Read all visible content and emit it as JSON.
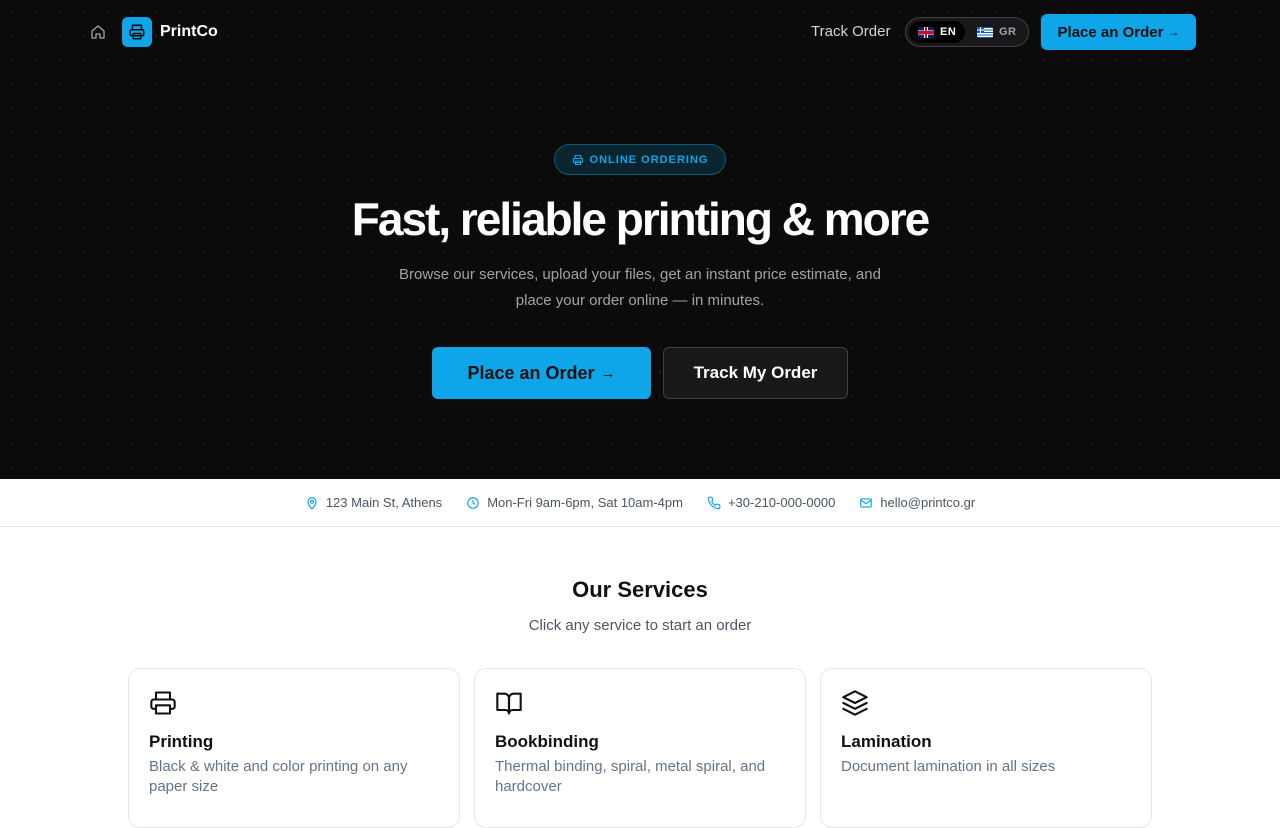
{
  "nav": {
    "brand": "PrintCo",
    "track_order": "Track Order",
    "languages": [
      {
        "code": "EN",
        "flag": "uk-flag-icon",
        "active": true
      },
      {
        "code": "GR",
        "flag": "greece-flag-icon",
        "active": false
      }
    ],
    "cta_label": "Place an Order",
    "cta_arrow": "→"
  },
  "hero": {
    "badge": "ONLINE ORDERING",
    "title": "Fast, reliable printing & more",
    "subtitle": "Browse our services, upload your files, get an instant price estimate, and place your order online — in minutes.",
    "primary_cta": "Place an Order",
    "primary_arrow": "→",
    "secondary_cta": "Track My Order"
  },
  "info": {
    "address": "123 Main St, Athens",
    "hours": "Mon-Fri 9am-6pm, Sat 10am-4pm",
    "phone": "+30-210-000-0000",
    "email": "hello@printco.gr"
  },
  "services": {
    "title": "Our Services",
    "subtitle": "Click any service to start an order",
    "items": [
      {
        "icon": "printer-icon",
        "title": "Printing",
        "description": "Black & white and color printing on any paper size"
      },
      {
        "icon": "book-icon",
        "title": "Bookbinding",
        "description": "Thermal binding, spiral, metal spiral, and hardcover"
      },
      {
        "icon": "layers-icon",
        "title": "Lamination",
        "description": "Document lamination in all sizes"
      }
    ]
  },
  "colors": {
    "accent": "#0ea5e9",
    "hero_bg": "#0b0b0c",
    "muted_text": "#64748b"
  }
}
